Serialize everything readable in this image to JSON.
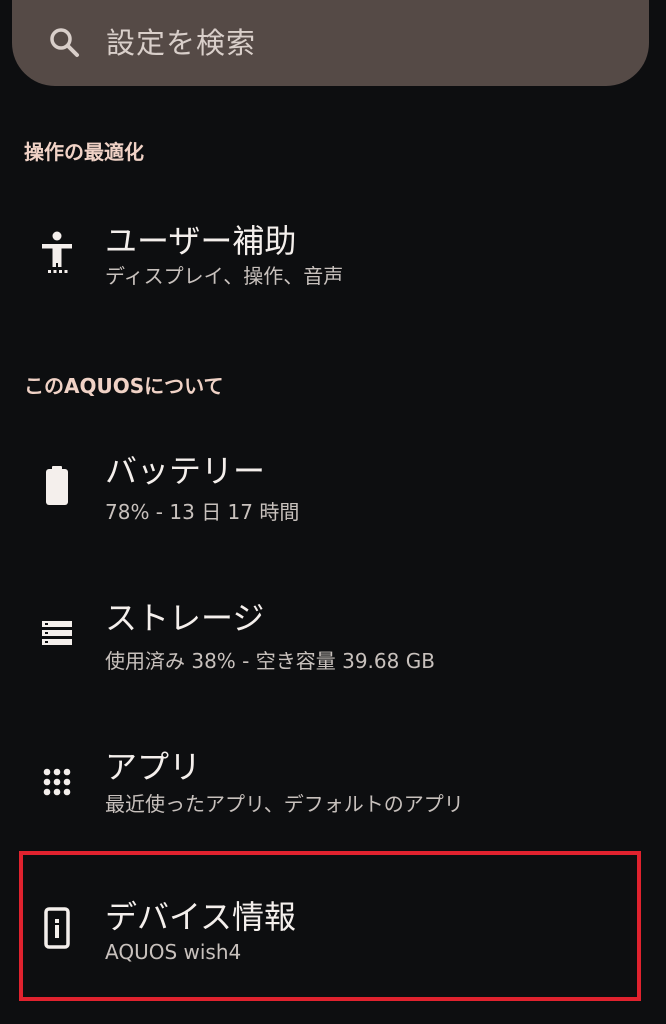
{
  "search": {
    "placeholder": "設定を検索",
    "icon": "search-icon"
  },
  "sections": [
    {
      "header": "操作の最適化",
      "items": [
        {
          "title": "ユーザー補助",
          "subtitle": "ディスプレイ、操作、音声",
          "icon": "accessibility-icon"
        }
      ]
    },
    {
      "header": "このAQUOSについて",
      "items": [
        {
          "title": "バッテリー",
          "subtitle": "78% - 13 日 17 時間",
          "icon": "battery-icon"
        },
        {
          "title": "ストレージ",
          "subtitle": "使用済み 38% - 空き容量 39.68 GB",
          "icon": "storage-icon"
        },
        {
          "title": "アプリ",
          "subtitle": "最近使ったアプリ、デフォルトのアプリ",
          "icon": "apps-grid-icon"
        },
        {
          "title": "デバイス情報",
          "subtitle": "AQUOS wish4",
          "icon": "device-info-icon",
          "highlighted": true
        }
      ]
    }
  ],
  "colors": {
    "background": "#0d0e10",
    "search_bar": "#554a46",
    "section_header": "#f0d2c6",
    "highlight": "#e0222e"
  }
}
